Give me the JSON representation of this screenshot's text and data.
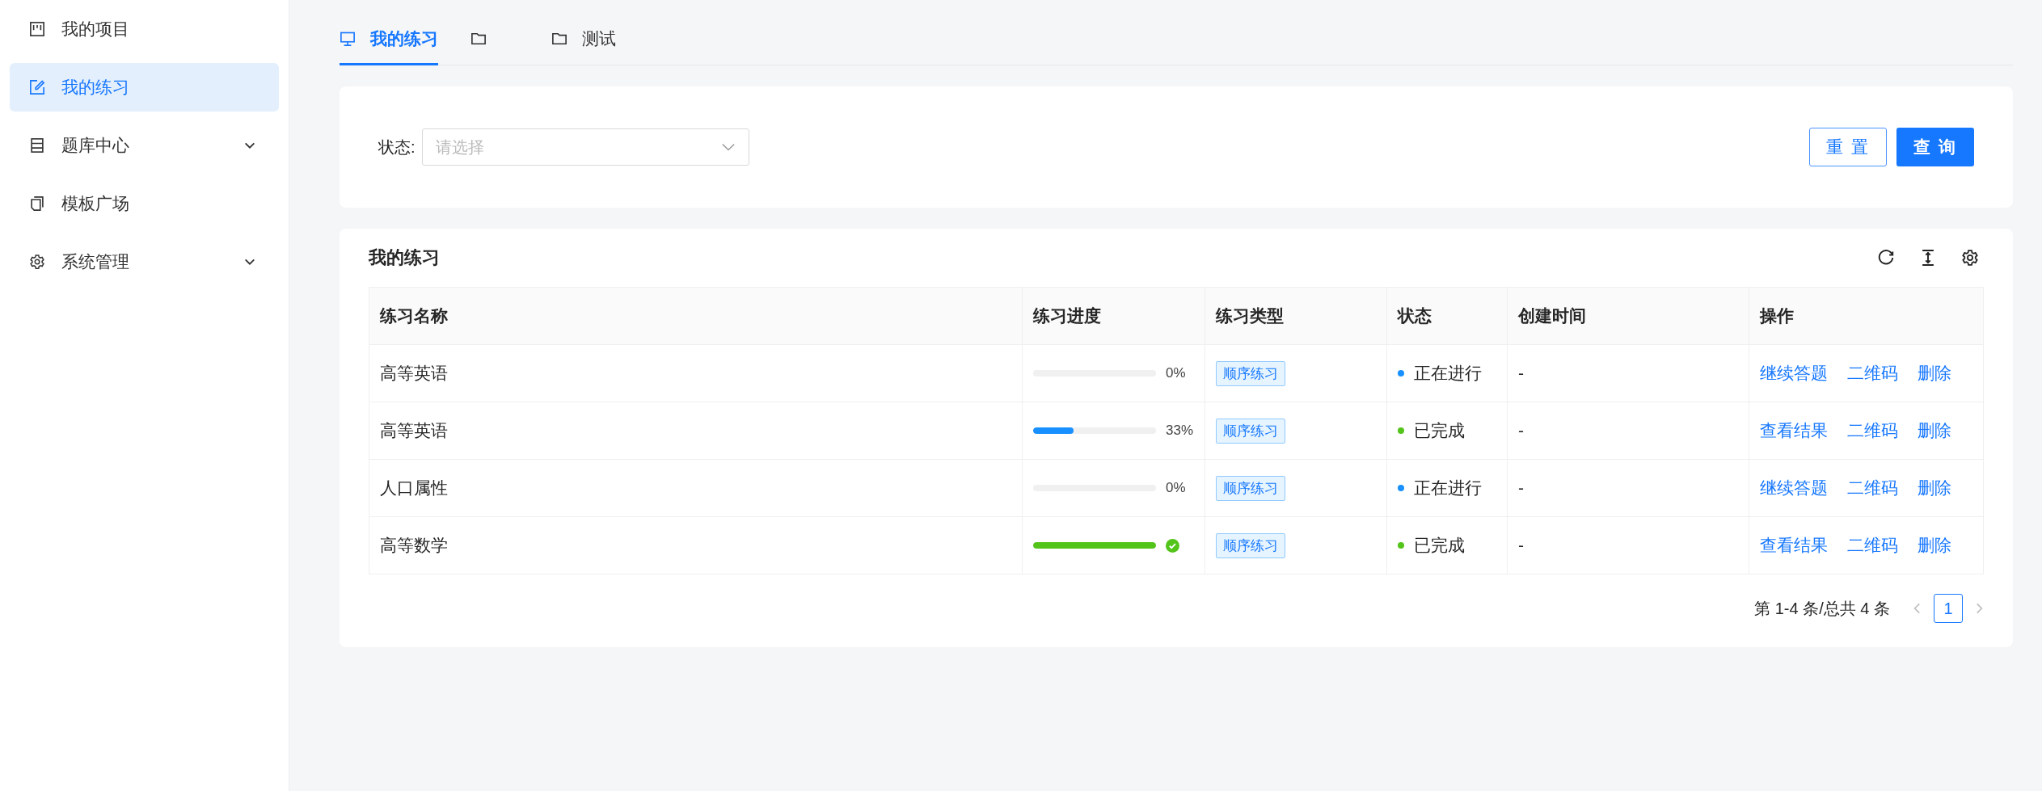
{
  "sidebar": {
    "items": [
      {
        "label": "我的项目",
        "selected": false,
        "expandable": false
      },
      {
        "label": "我的练习",
        "selected": true,
        "expandable": false
      },
      {
        "label": "题库中心",
        "selected": false,
        "expandable": true
      },
      {
        "label": "模板广场",
        "selected": false,
        "expandable": false
      },
      {
        "label": "系统管理",
        "selected": false,
        "expandable": true
      }
    ]
  },
  "tabs": [
    {
      "label": "我的练习",
      "selected": true
    },
    {
      "selected": false
    },
    {
      "label": "测试",
      "selected": false
    }
  ],
  "filter": {
    "label": "状态:",
    "placeholder": "请选择",
    "buttons": [
      {
        "label": "重 置",
        "kind": "secondary"
      },
      {
        "label": "查 询",
        "kind": "primary"
      }
    ]
  },
  "table": {
    "title": "我的练习",
    "columns": [
      "练习名称",
      "练习进度",
      "练习类型",
      "状态",
      "创建时间",
      "操作"
    ],
    "rows": [
      {
        "name": "高等英语",
        "progress": {
          "kind": "percent",
          "level": 0,
          "text": "0%"
        },
        "type": "顺序练习",
        "status": {
          "text": "正在进行",
          "color": "#1890ff"
        },
        "created": "-",
        "actions": [
          "继续答题",
          "二维码",
          "删除"
        ]
      },
      {
        "name": "高等英语",
        "progress": {
          "kind": "percent",
          "level": 0.33,
          "text": "33%"
        },
        "type": "顺序练习",
        "status": {
          "text": "已完成",
          "color": "#52c41a"
        },
        "created": "-",
        "actions": [
          "查看结果",
          "二维码",
          "删除"
        ]
      },
      {
        "name": "人口属性",
        "progress": {
          "kind": "percent",
          "level": 0,
          "text": "0%"
        },
        "type": "顺序练习",
        "status": {
          "text": "正在进行",
          "color": "#1890ff"
        },
        "created": "-",
        "actions": [
          "继续答题",
          "二维码",
          "删除"
        ]
      },
      {
        "name": "高等数学",
        "progress": {
          "kind": "done",
          "level": 1
        },
        "type": "顺序练习",
        "status": {
          "text": "已完成",
          "color": "#52c41a"
        },
        "created": "-",
        "actions": [
          "查看结果",
          "二维码",
          "删除"
        ]
      }
    ]
  },
  "pagination": {
    "summary": "第 1-4 条/总共 4 条",
    "pages": [
      {
        "label": "1",
        "selected": true
      }
    ]
  }
}
